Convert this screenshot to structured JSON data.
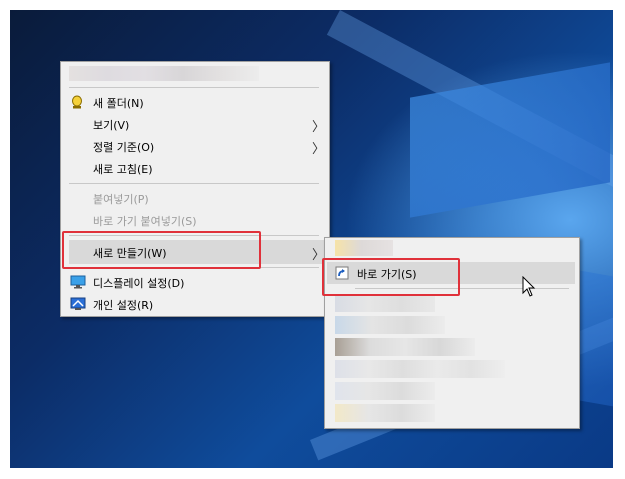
{
  "context_menu": {
    "items": [
      {
        "label": "새 폴더(N)",
        "enabled": true,
        "icon": "shortcut-icon"
      },
      {
        "label": "보기(V)",
        "enabled": true,
        "submenu": true
      },
      {
        "label": "정렬 기준(O)",
        "enabled": true,
        "submenu": true
      },
      {
        "label": "새로 고침(E)",
        "enabled": true
      },
      {
        "label": "붙여넣기(P)",
        "enabled": false
      },
      {
        "label": "바로 가기 붙여넣기(S)",
        "enabled": false
      },
      {
        "label": "새로 만들기(W)",
        "enabled": true,
        "submenu": true,
        "highlighted": true
      },
      {
        "label": "디스플레이 설정(D)",
        "enabled": true,
        "icon": "display-settings-icon"
      },
      {
        "label": "개인 설정(R)",
        "enabled": true,
        "icon": "personalize-icon"
      }
    ]
  },
  "new_submenu": {
    "items": [
      {
        "label": "바로 가기(S)",
        "icon": "shortcut-icon",
        "highlighted": true
      }
    ]
  },
  "glyphs": {
    "submenu_arrow": "〉"
  },
  "colors": {
    "highlight_box": "#e0313a",
    "menu_background": "#f0f0f0",
    "hover": "#d9d9d9"
  }
}
